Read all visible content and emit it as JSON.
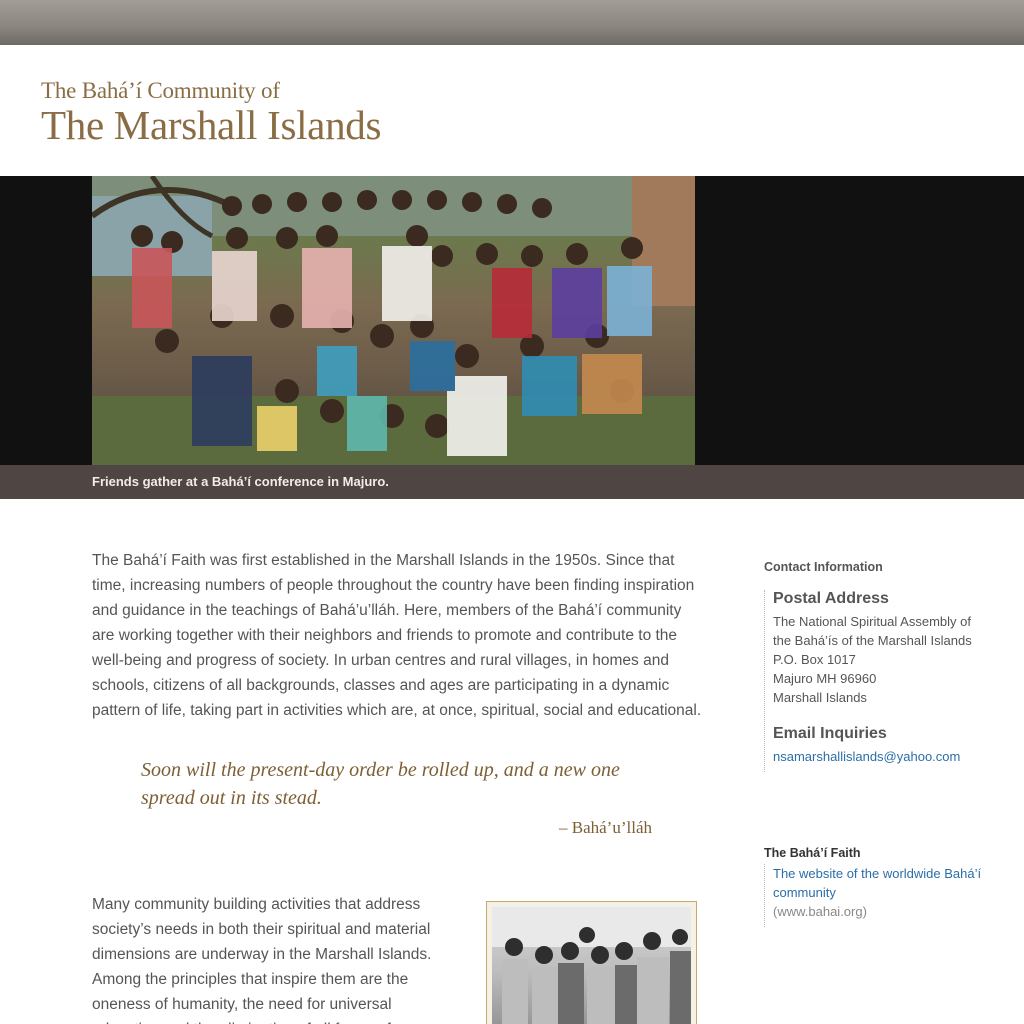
{
  "site": {
    "title_line1": "The Bahá’í Community of",
    "title_line2": "The Marshall Islands"
  },
  "hero": {
    "caption": "Friends gather at a Bahá’í conference in Majuro."
  },
  "main": {
    "intro": "The Bahá’í Faith was first established in the Marshall Islands in the 1950s. Since that time, increasing numbers of people throughout the country have been finding inspiration and guidance in the teachings of Bahá’u’lláh. Here, members of the Bahá’í community are working together with their neighbors and friends to promote and contribute to the well-being and progress of society. In urban centres and rural villages, in homes and schools, citizens of all backgrounds, classes and ages are participating in a dynamic pattern of life, taking part in activities which are, at once, spiritual, social and educational.",
    "quote": "Soon will the present-day order be rolled up, and a new one spread out in its stead.",
    "attribution": "– Bahá’u’lláh",
    "second_para": "Many community building activities that address society’s needs in both their spiritual and material dimensions are underway in the Marshall Islands. Among the principles that inspire them are the oneness of humanity, the need for universal education and the elimination of all forms of"
  },
  "sidebar": {
    "contact_heading": "Contact Information",
    "postal_heading": "Postal Address",
    "postal_lines": [
      "The National Spiritual Assembly of",
      "the Bahá’ís of the Marshall Islands",
      "P.O. Box 1017",
      "Majuro MH 96960",
      "Marshall Islands"
    ],
    "email_heading": "Email Inquiries",
    "email": "nsamarshallislands@yahoo.com",
    "faith_heading": "The Bahá’í Faith",
    "faith_link": "The website of the worldwide Bahá’í community",
    "faith_url_text": "(www.bahai.org)"
  },
  "colors": {
    "title": "#8a6d45",
    "quote": "#7d5f35",
    "link": "#2a6ea8",
    "caption_bar": "#4f4542"
  }
}
